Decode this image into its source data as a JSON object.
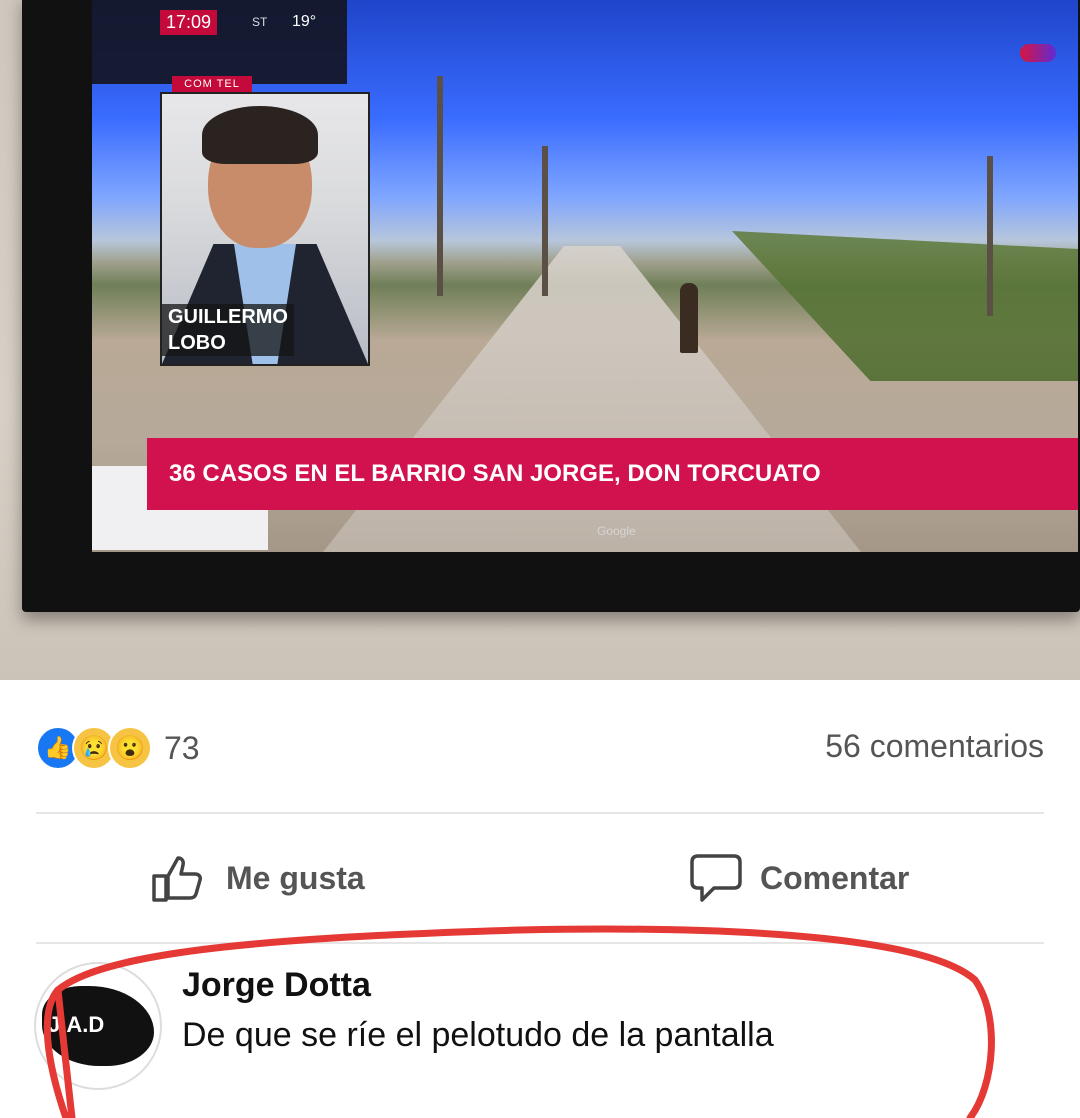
{
  "tv": {
    "time": "17:09",
    "extra": "ST",
    "temp": "19°",
    "tag": "COM TEL",
    "person_name_line1": "GUILLERMO",
    "person_name_line2": "LOBO",
    "ticker": "36 CASOS EN EL BARRIO SAN JORGE, DON TORCUATO",
    "map_credit": "Google"
  },
  "post": {
    "reactions_count": "73",
    "comments_count": "56 comentarios",
    "like_action": "Me gusta",
    "comment_action": "Comentar",
    "icons": {
      "like": "like-icon",
      "sad": "sad-icon",
      "wow": "wow-icon",
      "thumb": "thumb-icon",
      "comment": "comment-icon"
    }
  },
  "comment": {
    "author": "Jorge Dotta",
    "text": "De que se ríe el pelotudo de la pantalla",
    "avatar_label": "J.A.D"
  },
  "colors": {
    "ticker_bg": "#d1124e",
    "annotation": "#e53935",
    "facebook_blue": "#1877f2"
  }
}
